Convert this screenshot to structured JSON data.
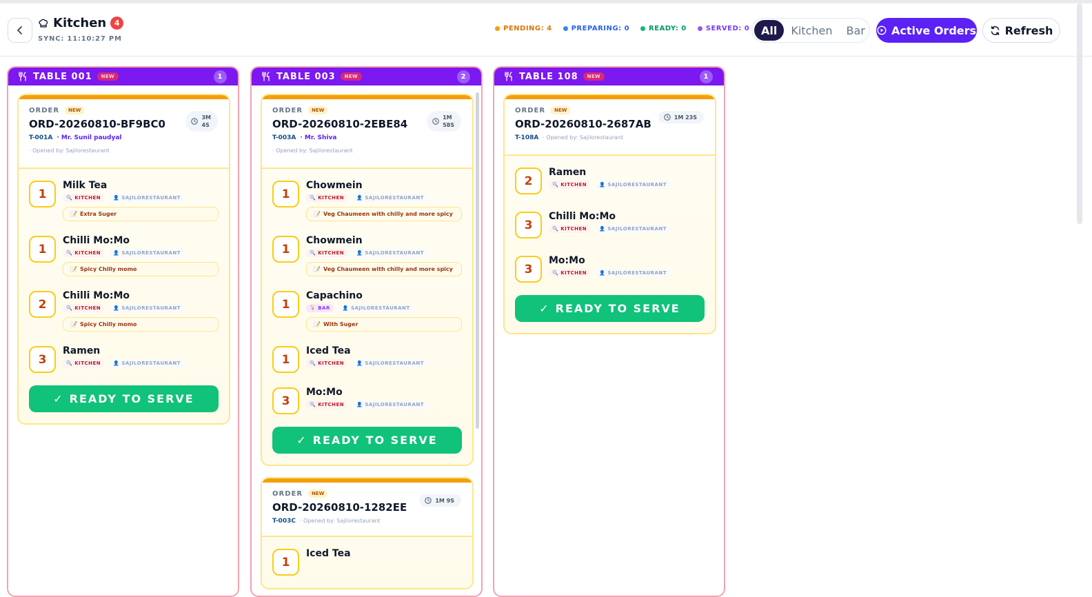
{
  "header": {
    "title": "Kitchen",
    "badge": "4",
    "sync": "SYNC: 11:10:27 PM",
    "stats": [
      {
        "label": "PENDING: 4",
        "color": "#f59e0b"
      },
      {
        "label": "PREPARING: 0",
        "color": "#3b82f6"
      },
      {
        "label": "READY: 0",
        "color": "#10b981"
      },
      {
        "label": "SERVED: 0",
        "color": "#8b5cf6"
      }
    ],
    "filters": [
      "All",
      "Kitchen",
      "Bar"
    ],
    "active_filter": "All",
    "active_orders_label": "Active Orders",
    "refresh_label": "Refresh"
  },
  "colors": {
    "accent": "#5b21f5",
    "column_header": "#7c18f0",
    "ready": "#10c27a"
  },
  "columns": [
    {
      "table": "TABLE 001",
      "new": "NEW",
      "count": "1",
      "orders": [
        {
          "label": "ORDER",
          "new": "NEW",
          "id": "ORD-20260810-BF9BC0",
          "timer_line1": "3M",
          "timer_line2": "4S",
          "table_code": "T-001A",
          "customer": "· Mr. Sunil paudyal",
          "opened": "· Opened by: Sajilorestaurant",
          "items": [
            {
              "qty": "1",
              "name": "Milk Tea",
              "station": "KITCHEN",
              "user": "SAJILORESTAURANT",
              "note": "Extra Suger"
            },
            {
              "qty": "1",
              "name": "Chilli Mo:Mo",
              "station": "KITCHEN",
              "user": "SAJILORESTAURANT",
              "note": "Spicy Chilly momo"
            },
            {
              "qty": "2",
              "name": "Chilli Mo:Mo",
              "station": "KITCHEN",
              "user": "SAJILORESTAURANT",
              "note": "Spicy Chilly momo"
            },
            {
              "qty": "3",
              "name": "Ramen",
              "station": "KITCHEN",
              "user": "SAJILORESTAURANT"
            }
          ],
          "ready_label": "READY TO SERVE"
        }
      ]
    },
    {
      "table": "TABLE 003",
      "new": "NEW",
      "count": "2",
      "orders": [
        {
          "label": "ORDER",
          "new": "NEW",
          "id": "ORD-20260810-2EBE84",
          "timer_line1": "1M",
          "timer_line2": "58S",
          "table_code": "T-003A",
          "customer": "· Mr. Shiva",
          "opened": "· Opened by: Sajilorestaurant",
          "items": [
            {
              "qty": "1",
              "name": "Chowmein",
              "station": "KITCHEN",
              "user": "SAJILORESTAURANT",
              "note": "Veg Chaumeen with chilly and more spicy"
            },
            {
              "qty": "1",
              "name": "Chowmein",
              "station": "KITCHEN",
              "user": "SAJILORESTAURANT",
              "note": "Veg Chaumeen with chilly and more spicy"
            },
            {
              "qty": "1",
              "name": "Capachino",
              "station": "BAR",
              "user": "SAJILORESTAURANT",
              "note": "With Suger"
            },
            {
              "qty": "1",
              "name": "Iced Tea",
              "station": "KITCHEN",
              "user": "SAJILORESTAURANT"
            },
            {
              "qty": "3",
              "name": "Mo:Mo",
              "station": "KITCHEN",
              "user": "SAJILORESTAURANT"
            }
          ],
          "ready_label": "READY TO SERVE"
        },
        {
          "label": "ORDER",
          "new": "NEW",
          "id": "ORD-20260810-1282EE",
          "timer_line1": "1M 9S",
          "timer_line2": "",
          "table_code": "T-003C",
          "customer": "",
          "opened": "· Opened by: Sajilorestaurant",
          "items": [
            {
              "qty": "1",
              "name": "Iced Tea",
              "station": "",
              "user": ""
            }
          ],
          "ready_label": ""
        }
      ]
    },
    {
      "table": "TABLE 108",
      "new": "NEW",
      "count": "1",
      "orders": [
        {
          "label": "ORDER",
          "new": "NEW",
          "id": "ORD-20260810-2687AB",
          "timer_line1": "1M 23S",
          "timer_line2": "",
          "table_code": "T-108A",
          "customer": "",
          "opened": "· Opened by: Sajilorestaurant",
          "items": [
            {
              "qty": "2",
              "name": "Ramen",
              "station": "KITCHEN",
              "user": "SAJILORESTAURANT"
            },
            {
              "qty": "3",
              "name": "Chilli Mo:Mo",
              "station": "KITCHEN",
              "user": "SAJILORESTAURANT"
            },
            {
              "qty": "3",
              "name": "Mo:Mo",
              "station": "KITCHEN",
              "user": "SAJILORESTAURANT"
            }
          ],
          "ready_label": "READY TO SERVE"
        }
      ]
    }
  ]
}
